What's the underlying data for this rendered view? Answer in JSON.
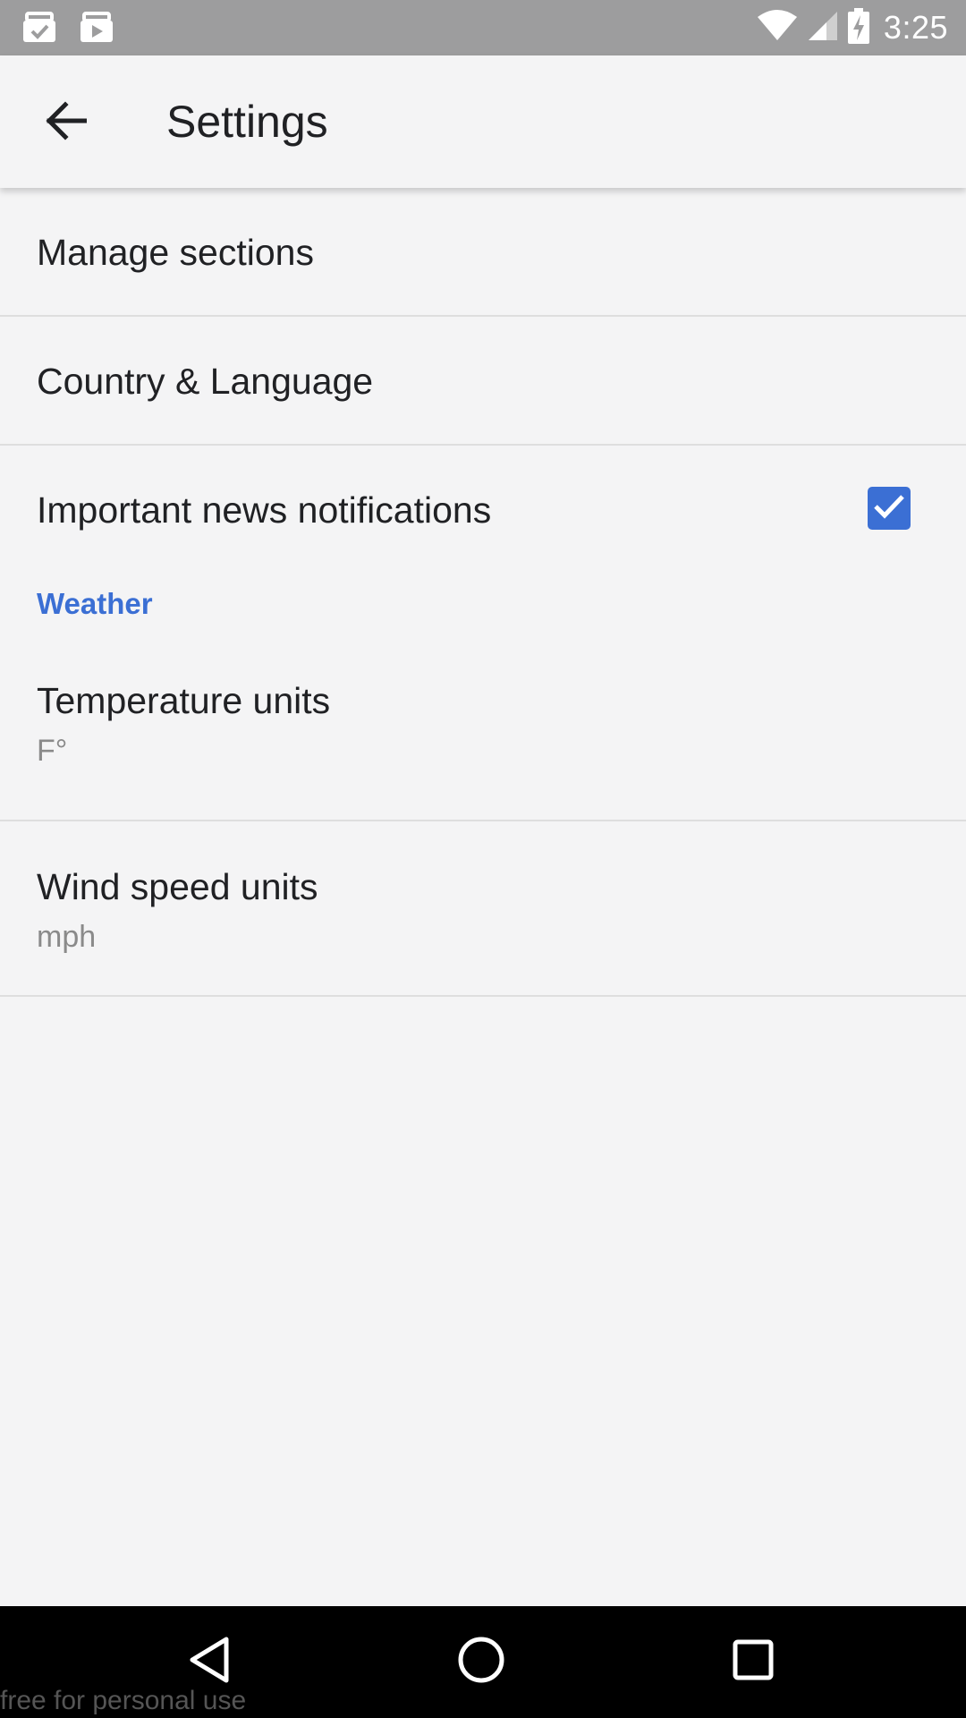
{
  "status_bar": {
    "time": "3:25",
    "left_icons": [
      "briefcase-check-icon",
      "briefcase-play-icon"
    ],
    "right_icons": [
      "wifi-icon",
      "cell-signal-icon",
      "battery-charging-icon"
    ]
  },
  "app_bar": {
    "back_icon": "arrow-back-icon",
    "title": "Settings"
  },
  "settings": {
    "manage_sections": "Manage sections",
    "country_language": "Country & Language",
    "notifications": {
      "label": "Important news notifications",
      "checked": true
    },
    "weather_header": "Weather",
    "temperature": {
      "label": "Temperature units",
      "value": "F°"
    },
    "wind": {
      "label": "Wind speed units",
      "value": "mph"
    }
  },
  "nav_bar": {
    "icons": [
      "back-triangle-icon",
      "home-circle-icon",
      "recents-square-icon"
    ]
  },
  "watermark": "free for personal use",
  "colors": {
    "accent": "#3b6fd4",
    "background": "#f4f4f5",
    "status_bar": "#9d9d9e",
    "nav_bar": "#000000"
  }
}
